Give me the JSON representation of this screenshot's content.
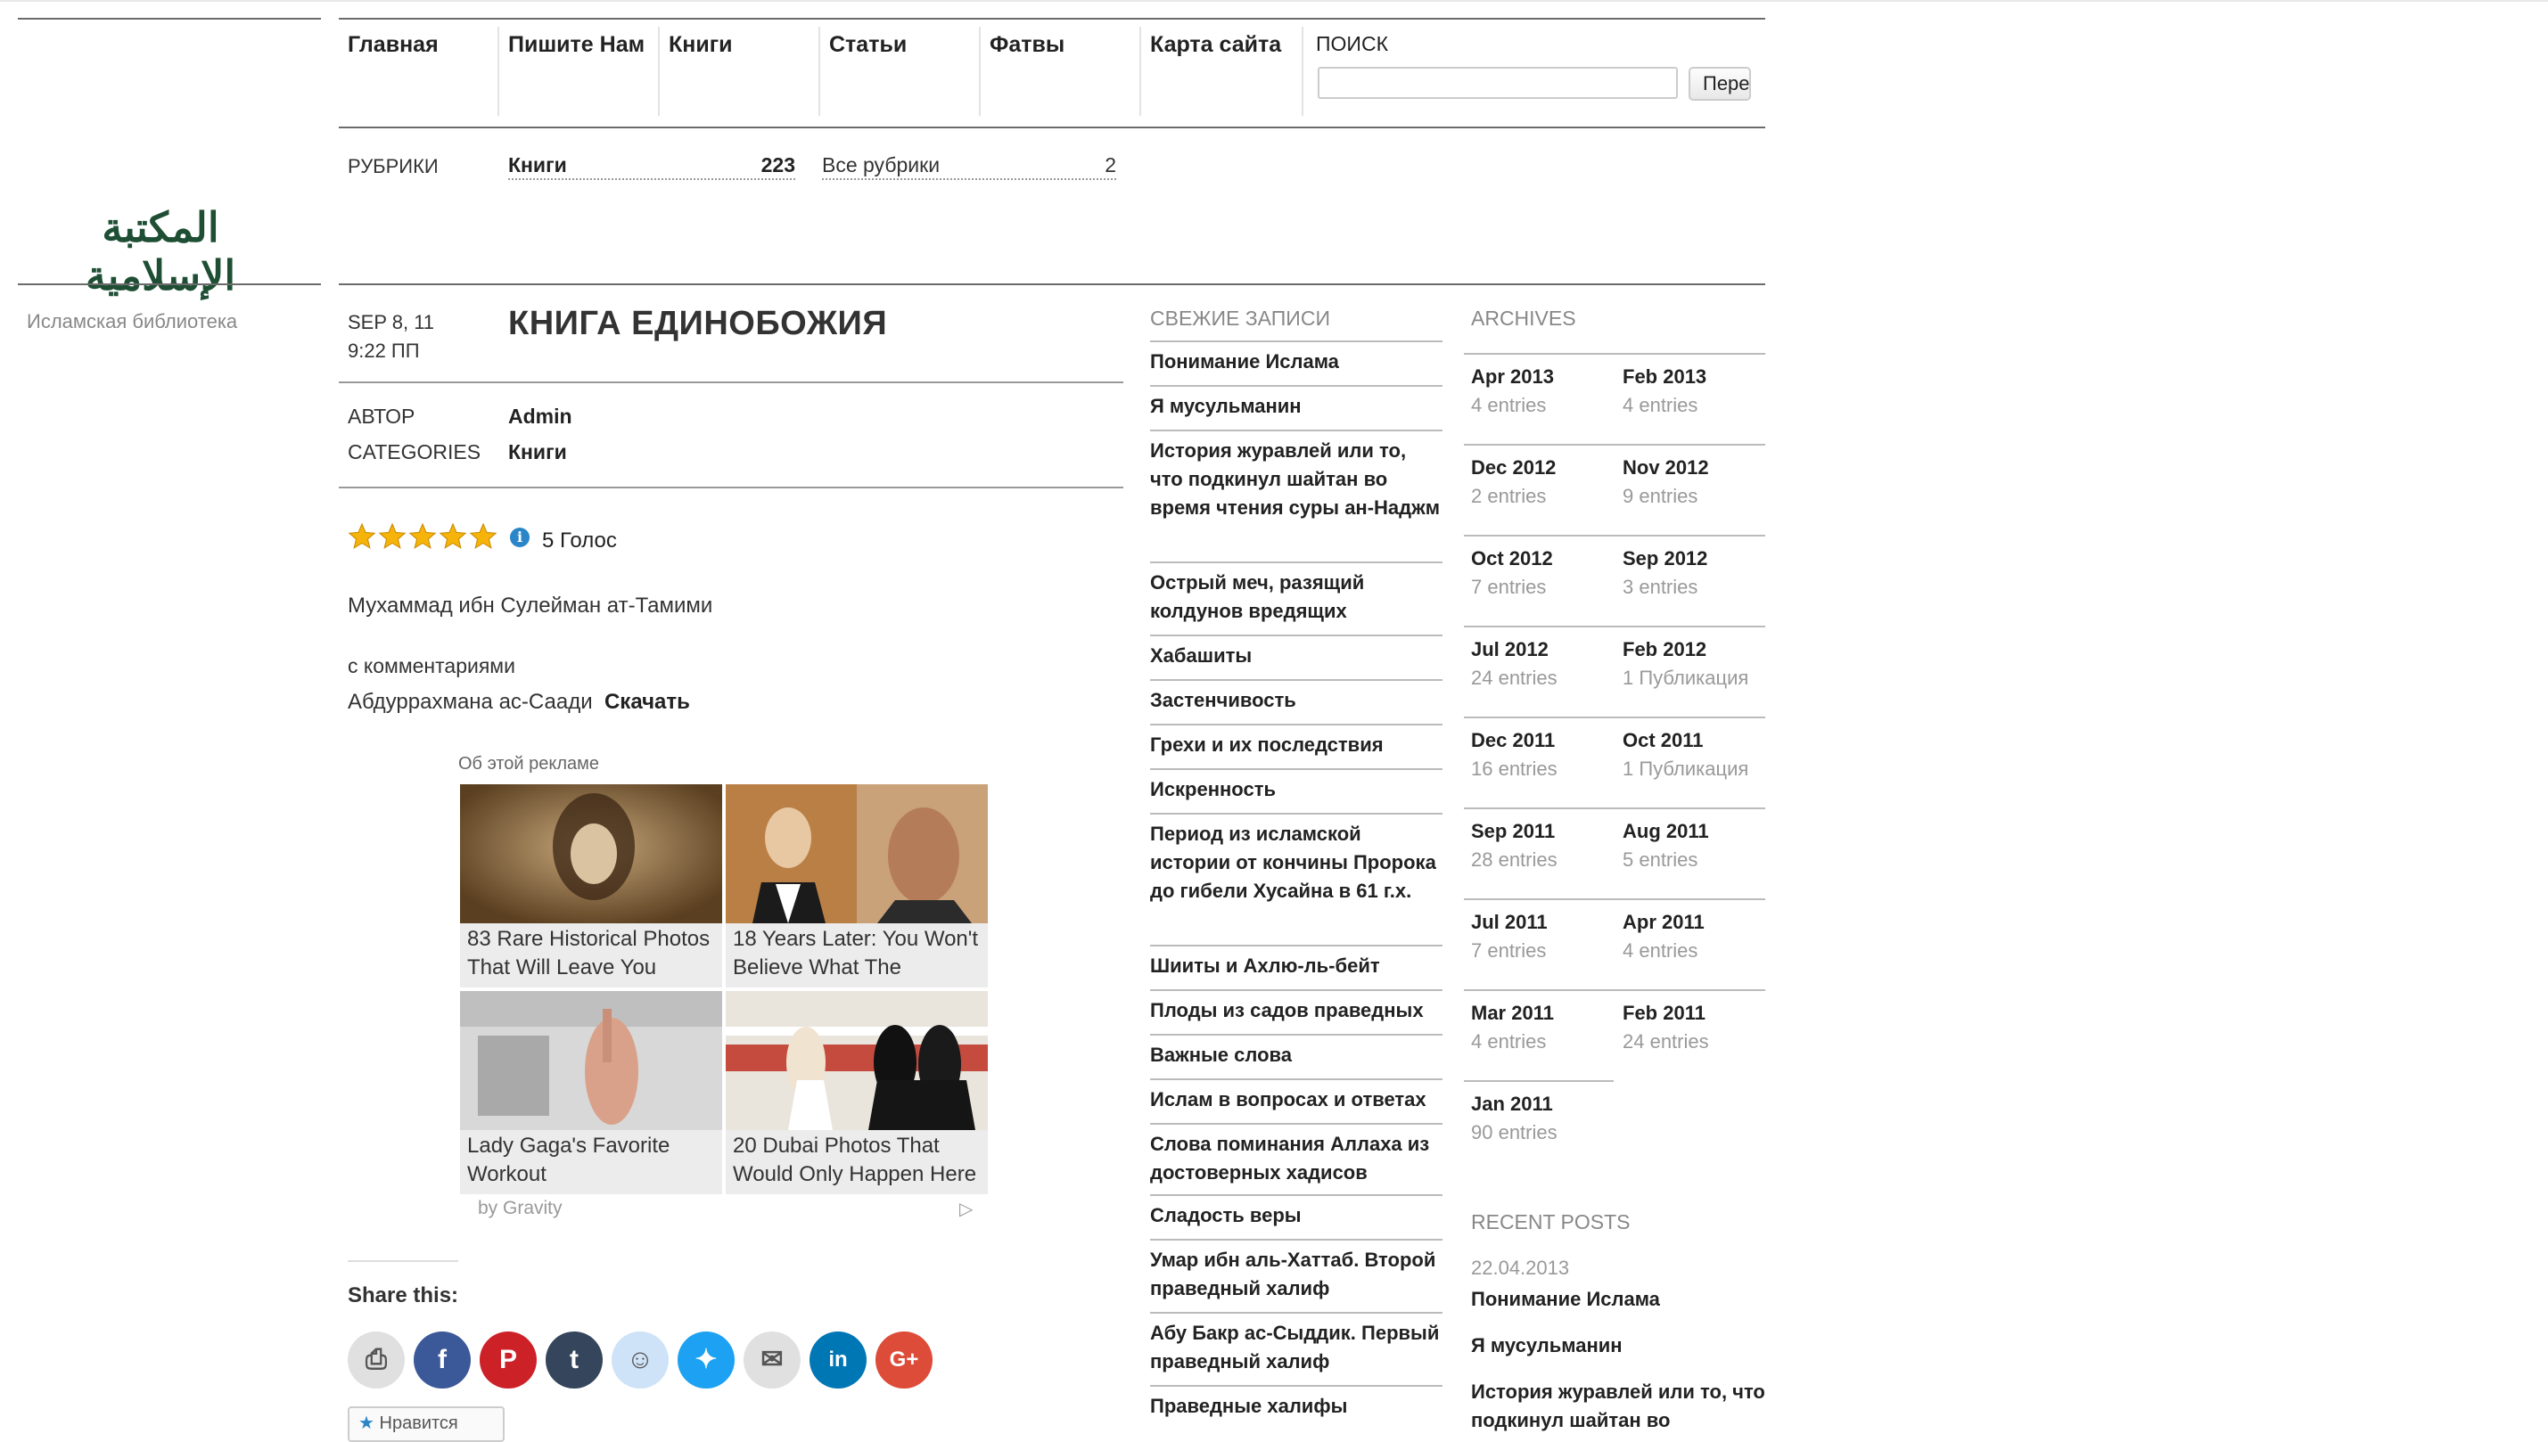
{
  "site": {
    "logo_text": "المكتبة الإسلامية",
    "description": "Исламская библиотека"
  },
  "nav": {
    "items": [
      "Главная",
      "Пишите Нам",
      "Книги",
      "Статьи",
      "Фатвы",
      "Карта сайта"
    ],
    "search_label": "ПОИСК",
    "search_value": "",
    "search_button": "Пере"
  },
  "rubrics": {
    "label": "РУБРИКИ",
    "items": [
      {
        "name": "Книги",
        "count": "223"
      },
      {
        "name": "Все рубрики",
        "count": "2"
      }
    ]
  },
  "post": {
    "date_line1": "SEP 8, 11",
    "date_line2": "9:22 ПП",
    "title": "КНИГА ЕДИНОБОЖИЯ",
    "author_label": "АВТОР",
    "author": "Admin",
    "categories_label": "CATEGORIES",
    "category": "Книги",
    "rating": 5,
    "votes": "5 Голос",
    "author_line": "Мухаммад ибн Сулейман ат-Тамими",
    "comments_line": "с комментариями",
    "commentator": "Абдуррахмана ас-Саади",
    "download": "Скачать"
  },
  "ad": {
    "about": "Об этой рекламе",
    "by": "by Gravity",
    "cards": [
      {
        "caption": "83 Rare Historical Photos That Will Leave You"
      },
      {
        "caption": "18 Years Later: You Won't Believe What The"
      },
      {
        "caption": "Lady Gaga's Favorite Workout"
      },
      {
        "caption": "20 Dubai Photos That Would Only Happen Here"
      }
    ]
  },
  "share": {
    "title": "Share this:",
    "buttons": [
      {
        "name": "print",
        "icon": "print-icon",
        "color": "#e0e0e0"
      },
      {
        "name": "facebook",
        "icon": "facebook-icon",
        "color": "#3b5998"
      },
      {
        "name": "pinterest",
        "icon": "pinterest-icon",
        "color": "#cc2127"
      },
      {
        "name": "tumblr",
        "icon": "tumblr-icon",
        "color": "#35465c"
      },
      {
        "name": "reddit",
        "icon": "reddit-icon",
        "color": "#cee3f8"
      },
      {
        "name": "twitter",
        "icon": "twitter-icon",
        "color": "#1da1f2"
      },
      {
        "name": "email",
        "icon": "email-icon",
        "color": "#e0e0e0"
      },
      {
        "name": "linkedin",
        "icon": "linkedin-icon",
        "color": "#0077b5"
      },
      {
        "name": "google-plus",
        "icon": "google-plus-icon",
        "color": "#dd4b39"
      }
    ],
    "like_label": "Нравится"
  },
  "fresh": {
    "heading": "СВЕЖИЕ ЗАПИСИ",
    "items": [
      "Понимание Ислама",
      "Я мусульманин",
      "История журавлей или то, что подкинул шайтан во время чтения суры ан-Наджм",
      "Острый меч, разящий колдунов вредящих",
      "Хабашиты",
      "Застенчивость",
      "Грехи и их последствия",
      "Искренность",
      "Период из исламской истории от кончины Пророка до гибели Хусайна в 61 г.х.",
      "Шииты и Ахлю-ль-бейт",
      "Плоды из садов праведных",
      "Важные слова",
      "Ислам в вопросах и ответах",
      "Слова поминания Аллаха из достоверных хадисов",
      "Сладость веры",
      "Умар ибн аль-Хаттаб. Второй праведный халиф",
      "Абу Бакр ас-Сыддик. Первый праведный халиф",
      "Праведные халифы"
    ]
  },
  "archives": {
    "heading": "ARCHIVES",
    "items": [
      {
        "month": "Apr 2013",
        "count": "4 entries"
      },
      {
        "month": "Feb 2013",
        "count": "4 entries"
      },
      {
        "month": "Dec 2012",
        "count": "2 entries"
      },
      {
        "month": "Nov 2012",
        "count": "9 entries"
      },
      {
        "month": "Oct 2012",
        "count": "7 entries"
      },
      {
        "month": "Sep 2012",
        "count": "3 entries"
      },
      {
        "month": "Jul 2012",
        "count": "24 entries"
      },
      {
        "month": "Feb 2012",
        "count": "1 Публикация"
      },
      {
        "month": "Dec 2011",
        "count": "16 entries"
      },
      {
        "month": "Oct 2011",
        "count": "1 Публикация"
      },
      {
        "month": "Sep 2011",
        "count": "28 entries"
      },
      {
        "month": "Aug 2011",
        "count": "5 entries"
      },
      {
        "month": "Jul 2011",
        "count": "7 entries"
      },
      {
        "month": "Apr 2011",
        "count": "4 entries"
      },
      {
        "month": "Mar 2011",
        "count": "4 entries"
      },
      {
        "month": "Feb 2011",
        "count": "24 entries"
      },
      {
        "month": "Jan 2011",
        "count": "90 entries"
      }
    ]
  },
  "recent_posts": {
    "heading": "RECENT POSTS",
    "items": [
      {
        "date": "22.04.2013",
        "title": "Понимание Ислама"
      },
      {
        "date": "",
        "title": "Я мусульманин"
      },
      {
        "date": "",
        "title": "История журавлей или то, что подкинул шайтан во"
      }
    ]
  },
  "colors": {
    "logo_green": "#1e4f34",
    "star_gold": "#f6b40b",
    "info_blue": "#2a86c8"
  }
}
